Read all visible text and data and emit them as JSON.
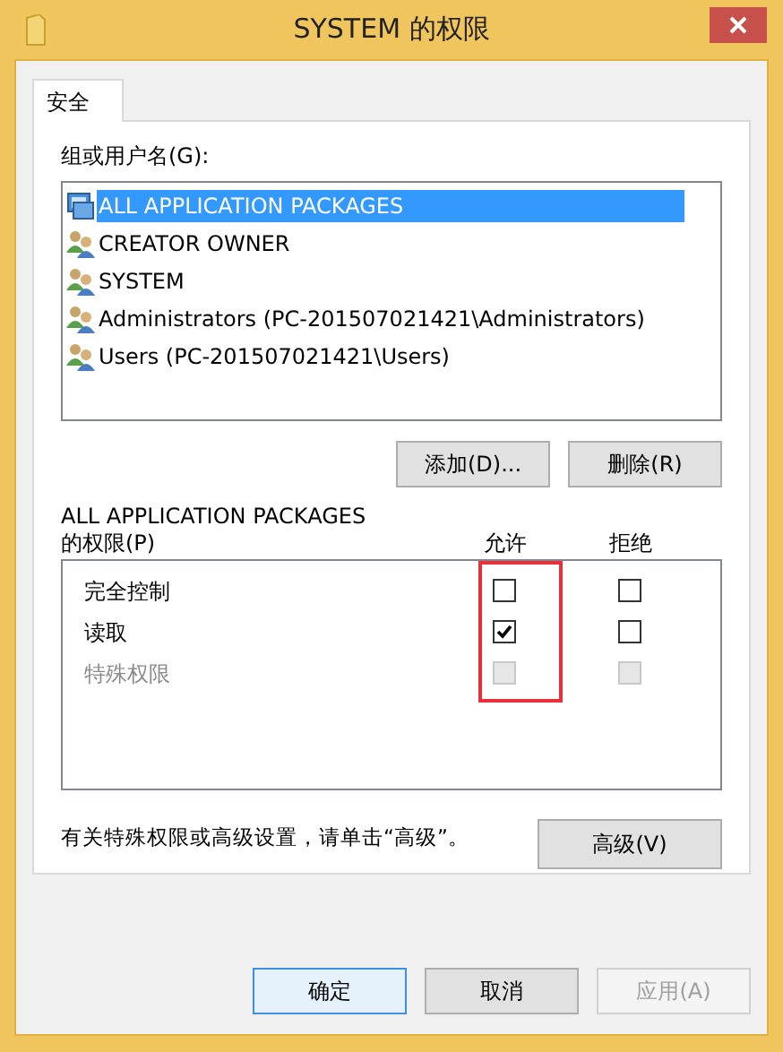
{
  "window": {
    "title": "SYSTEM 的权限"
  },
  "tabs": [
    {
      "label": "安全",
      "selected": true
    }
  ],
  "group_label": "组或用户名(G):",
  "users": [
    {
      "name": "ALL APPLICATION PACKAGES",
      "kind": "package",
      "selected": true
    },
    {
      "name": "CREATOR OWNER",
      "kind": "group",
      "selected": false
    },
    {
      "name": "SYSTEM",
      "kind": "group",
      "selected": false
    },
    {
      "name": "Administrators (PC-201507021421\\Administrators)",
      "kind": "group",
      "selected": false
    },
    {
      "name": "Users (PC-201507021421\\Users)",
      "kind": "group",
      "selected": false
    }
  ],
  "user_buttons": [
    {
      "label": "添加(D)..."
    },
    {
      "label": "删除(R)"
    }
  ],
  "permissions_label": [
    "ALL APPLICATION PACKAGES",
    "的权限(P)"
  ],
  "columns": [
    "允许",
    "拒绝"
  ],
  "permissions": [
    {
      "name": "完全控制",
      "allow": false,
      "deny": false,
      "disabled": false
    },
    {
      "name": "读取",
      "allow": true,
      "deny": false,
      "disabled": false
    },
    {
      "name": "特殊权限",
      "allow": false,
      "deny": false,
      "disabled": true
    }
  ],
  "note": "有关特殊权限或高级设置，请单击“高级”。",
  "advanced_button": "高级(V)",
  "buttons": [
    {
      "label": "确定",
      "default": true,
      "disabled": false
    },
    {
      "label": "取消",
      "default": false,
      "disabled": false
    },
    {
      "label": "应用(A)",
      "default": false,
      "disabled": true
    }
  ]
}
